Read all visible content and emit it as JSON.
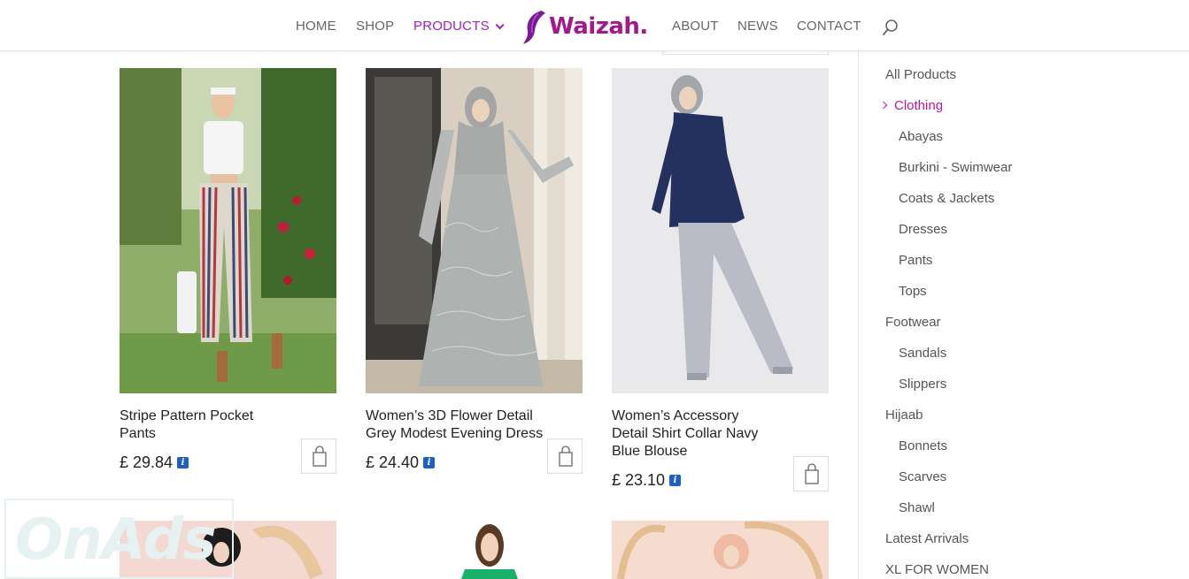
{
  "nav": {
    "home": "HOME",
    "shop": "SHOP",
    "products": "PRODUCTS",
    "about": "ABOUT",
    "news": "NEWS",
    "contact": "CONTACT"
  },
  "logo": {
    "text": "Waizah."
  },
  "colors": {
    "accent": "#a020c0",
    "brand": "#a01a8e",
    "active_category": "#c0169a"
  },
  "products": [
    {
      "title_line1": "Stripe Pattern Pocket",
      "title_line2": "Pants",
      "title_line3": "",
      "price": "£ 29.84"
    },
    {
      "title_line1": "Women’s 3D Flower Detail",
      "title_line2": "Grey Modest Evening Dress",
      "title_line3": "",
      "price": "£ 24.40"
    },
    {
      "title_line1": "Women’s Accessory",
      "title_line2": "Detail Shirt Collar Navy",
      "title_line3": "Blue Blouse",
      "price": "£ 23.10"
    }
  ],
  "sidebar": {
    "all_products": "All Products",
    "clothing": "Clothing",
    "abayas": "Abayas",
    "burkini": "Burkini - Swimwear",
    "coats": "Coats & Jackets",
    "dresses": "Dresses",
    "pants": "Pants",
    "tops": "Tops",
    "footwear": "Footwear",
    "sandals": "Sandals",
    "slippers": "Slippers",
    "hijaab": "Hijaab",
    "bonnets": "Bonnets",
    "scarves": "Scarves",
    "shawl": "Shawl",
    "latest": "Latest Arrivals",
    "xl": "XL FOR WOMEN"
  },
  "icons": {
    "search": "search-icon",
    "cart": "shopping-bag-icon",
    "info": "info-icon",
    "chevron": "chevron-down-icon"
  },
  "watermark": "OnAds"
}
